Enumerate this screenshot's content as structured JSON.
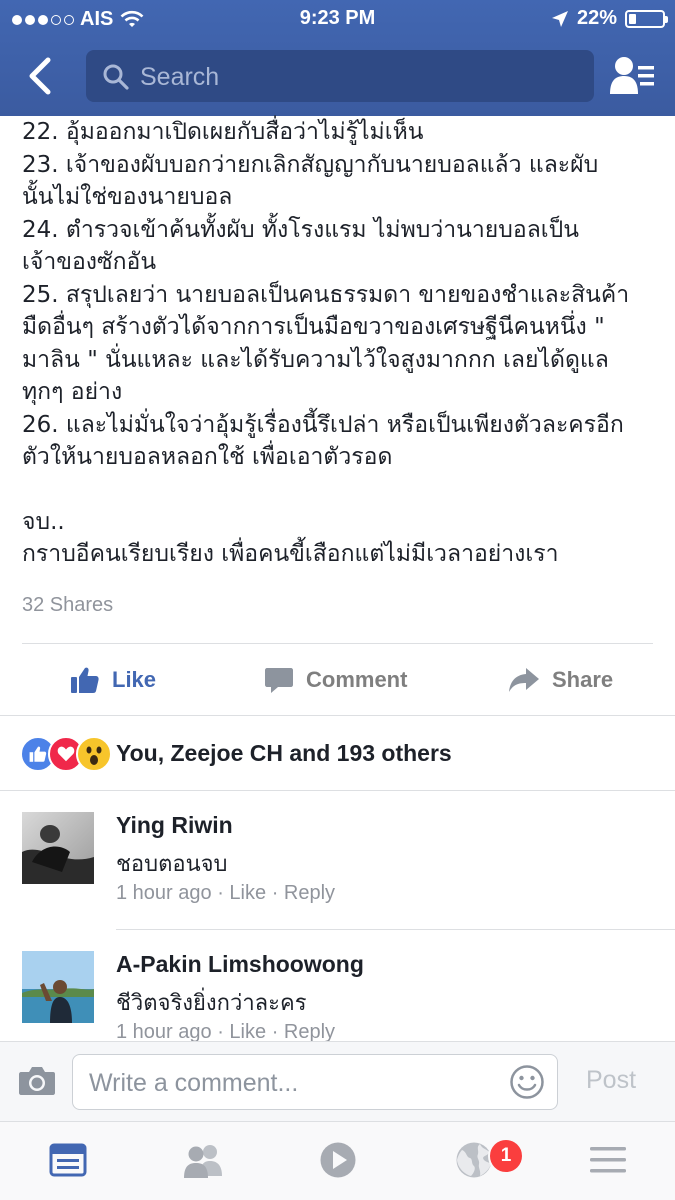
{
  "status_bar": {
    "carrier": "AIS",
    "time": "9:23 PM",
    "battery": "22%",
    "battery_level": 0.22
  },
  "nav": {
    "search_placeholder": "Search"
  },
  "post": {
    "lines": [
      "22. อุ้มออกมาเปิดเผยกับสื่อว่าไม่รู้ไม่เห็น",
      "23. เจ้าของผับบอกว่ายกเลิกสัญญากับนายบอลแล้ว และผับ",
      "นั้นไม่ใช่ของนายบอล",
      "24. ตำรวจเข้าค้นทั้งผับ ทั้งโรงแรม ไม่พบว่านายบอลเป็น",
      "เจ้าของซักอัน",
      "25. สรุปเลยว่า นายบอลเป็นคนธรรมดา ขายของชำและสินค้า",
      "มืดอื่นๆ สร้างตัวได้จากการเป็นมือขวาของเศรษฐีนีคนหนึ่ง \"",
      "มาลิน \" นั่นแหละ และได้รับความไว้ใจสูงมากกก เลยได้ดูแล",
      "ทุกๆ อย่าง",
      "26. และไม่มั่นใจว่าอุ้มรู้เรื่องนี้รึเปล่า หรือเป็นเพียงตัวละครอีก",
      "ตัวให้นายบอลหลอกใช้ เพื่อเอาตัวรอด"
    ],
    "ending_lines": [
      "จบ..",
      "กราบอีคนเรียบเรียง เพื่อคนขี้เสือกแต่ไม่มีเวลาอย่างเรา"
    ],
    "shares": "32 Shares"
  },
  "actions": {
    "like": "Like",
    "comment": "Comment",
    "share": "Share"
  },
  "reactions": {
    "summary": "You, Zeejoe CH and 193 others",
    "icons": [
      "like-reaction-icon",
      "love-reaction-icon",
      "wow-reaction-icon"
    ]
  },
  "comments": [
    {
      "name": "Ying Riwin",
      "text": "ชอบตอนจบ",
      "time": "1 hour ago",
      "like": "Like",
      "reply": "Reply"
    },
    {
      "name": "A-Pakin Limshoowong",
      "text": "ชีวิตจริงยิ่งกว่าละคร",
      "time": "1 hour ago",
      "like": "Like",
      "reply": "Reply"
    }
  ],
  "composer": {
    "placeholder": "Write a comment...",
    "post": "Post"
  },
  "tabbar": {
    "notification_badge": "1"
  },
  "colors": {
    "brand": "#3b5998",
    "link_blue": "#4267b2",
    "badge_red": "#fa3e3e",
    "meta_gray": "#90949c"
  }
}
